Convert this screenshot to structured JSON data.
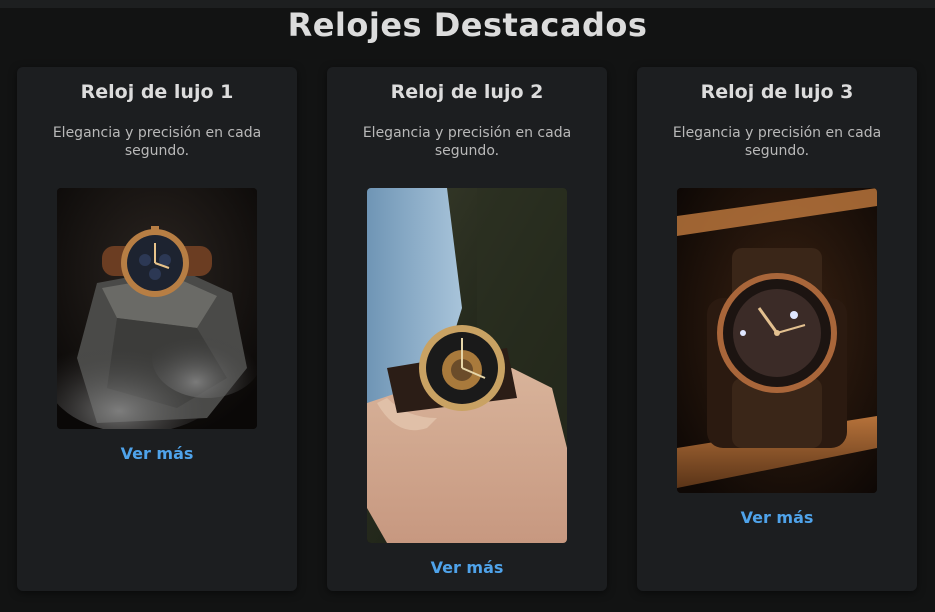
{
  "page": {
    "title": "Relojes Destacados"
  },
  "products": [
    {
      "name": "Reloj de lujo 1",
      "description": "Elegancia y precisión en cada segundo.",
      "link": "Ver más",
      "image": "watch-on-rock-photo"
    },
    {
      "name": "Reloj de lujo 2",
      "description": "Elegancia y precisión en cada segundo.",
      "link": "Ver más",
      "image": "watch-on-wrist-photo"
    },
    {
      "name": "Reloj de lujo 3",
      "description": "Elegancia y precisión en cada segundo.",
      "link": "Ver más",
      "image": "watch-in-box-photo"
    }
  ],
  "colors": {
    "background": "#121313",
    "card": "#1c1e20",
    "link": "#4fa3ea",
    "title": "#dcdcdc"
  }
}
